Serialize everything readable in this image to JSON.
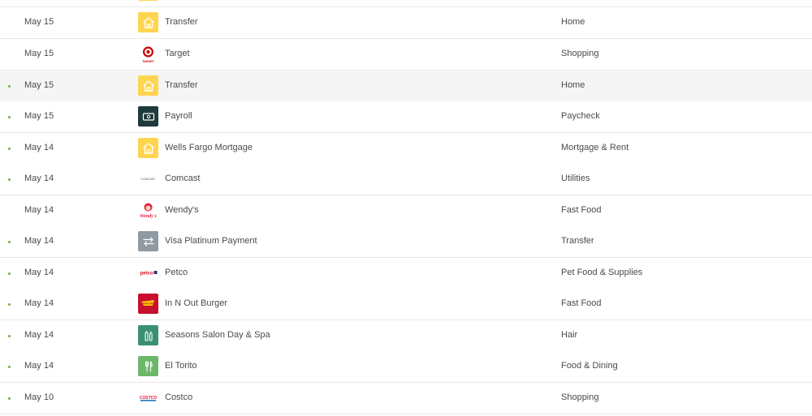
{
  "transactions": [
    {
      "date": "May 15",
      "merchant": "Transfer",
      "category": "Home",
      "logo": "home-icon",
      "dot": false
    },
    {
      "date": "May 15",
      "merchant": "Target",
      "category": "Shopping",
      "logo": "target-logo",
      "logo_text": "TARGET",
      "dot": false
    },
    {
      "date": "May 15",
      "merchant": "Transfer",
      "category": "Home",
      "logo": "home-icon",
      "dot": true
    },
    {
      "date": "May 15",
      "merchant": "Payroll",
      "category": "Paycheck",
      "logo": "cash-icon",
      "dot": true
    },
    {
      "date": "May 14",
      "merchant": "Wells Fargo Mortgage",
      "category": "Mortgage & Rent",
      "logo": "home-icon",
      "dot": true
    },
    {
      "date": "May 14",
      "merchant": "Comcast",
      "category": "Utilities",
      "logo": "comcast-logo",
      "logo_text": "COMCAST",
      "dot": true
    },
    {
      "date": "May 14",
      "merchant": "Wendy's",
      "category": "Fast Food",
      "logo": "wendys-logo",
      "logo_text": "Wendy's",
      "dot": false
    },
    {
      "date": "May 14",
      "merchant": "Visa Platinum Payment",
      "category": "Transfer",
      "logo": "transfer-arrows-icon",
      "dot": true
    },
    {
      "date": "May 14",
      "merchant": "Petco",
      "category": "Pet Food & Supplies",
      "logo": "petco-logo",
      "logo_text": "petco",
      "dot": true
    },
    {
      "date": "May 14",
      "merchant": "In N Out Burger",
      "category": "Fast Food",
      "logo": "innout-logo",
      "logo_text": "IN-N-OUT",
      "dot": true
    },
    {
      "date": "May 14",
      "merchant": "Seasons Salon Day & Spa",
      "category": "Hair",
      "logo": "salon-icon",
      "dot": true
    },
    {
      "date": "May 14",
      "merchant": "El Torito",
      "category": "Food & Dining",
      "logo": "utensils-icon",
      "dot": true
    },
    {
      "date": "May 10",
      "merchant": "Costco",
      "category": "Shopping",
      "logo": "costco-logo",
      "logo_text": "COSTCO",
      "dot": true
    }
  ],
  "colors": {
    "unreviewed_dot": "#6db33f",
    "home_bg": "#ffd54f",
    "payroll_bg": "#1e3a3d",
    "transfer_bg": "#8f9aa3",
    "salon_bg": "#3b8f73",
    "dining_bg": "#6cb86a",
    "row_highlight": "#f5f5f5"
  }
}
